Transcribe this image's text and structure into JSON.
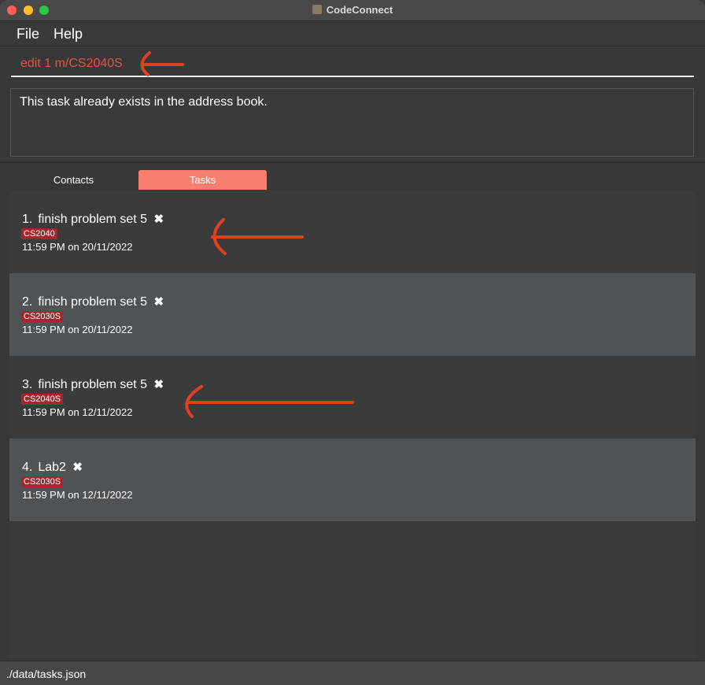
{
  "window": {
    "title": "CodeConnect"
  },
  "menu": {
    "file": "File",
    "help": "Help"
  },
  "command": {
    "value": "edit 1 m/CS2040S"
  },
  "result": {
    "message": "This task already exists in the address book."
  },
  "tabs": [
    {
      "label": "Contacts",
      "active": false
    },
    {
      "label": "Tasks",
      "active": true
    }
  ],
  "tasks": [
    {
      "index": "1.",
      "name": "finish problem set 5",
      "module": "CS2040",
      "deadline": "11:59 PM on 20/11/2022"
    },
    {
      "index": "2.",
      "name": "finish problem set 5",
      "module": "CS2030S",
      "deadline": "11:59 PM on 20/11/2022"
    },
    {
      "index": "3.",
      "name": "finish problem set 5",
      "module": "CS2040S",
      "deadline": "11:59 PM on 12/11/2022"
    },
    {
      "index": "4.",
      "name": "Lab2",
      "module": "CS2030S",
      "deadline": "11:59 PM on 12/11/2022"
    }
  ],
  "status": {
    "path": "./data/tasks.json"
  },
  "icons": {
    "delete": "x-mark-icon",
    "annotation": "arrow-left-icon"
  },
  "colors": {
    "accent": "#f77f6e",
    "tag": "#a3272f",
    "command_text": "#e0553f",
    "annotation": "#e0401f"
  }
}
